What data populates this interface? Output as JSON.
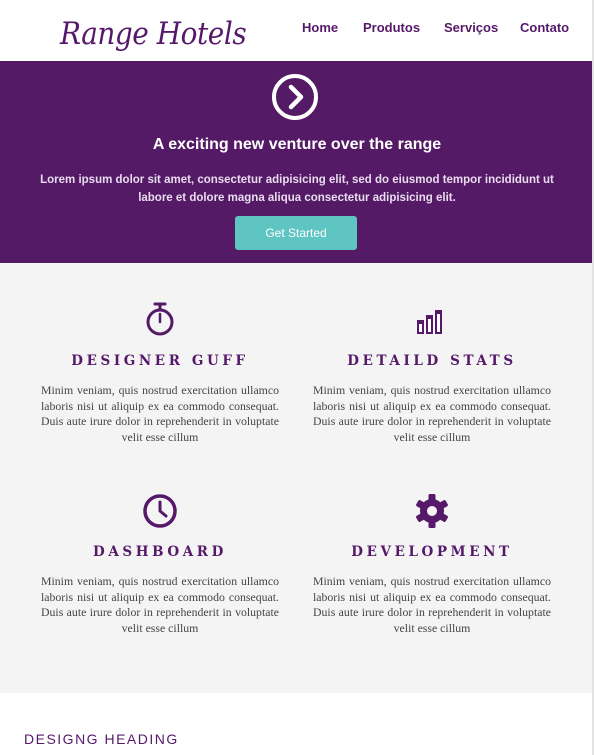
{
  "header": {
    "logo": "Range Hotels",
    "nav": [
      {
        "label": "Home"
      },
      {
        "label": "Produtos"
      },
      {
        "label": "Serviços"
      },
      {
        "label": "Contato"
      }
    ]
  },
  "hero": {
    "icon": "chevron-right-circle-icon",
    "title": "A exciting new venture over the range",
    "text": "Lorem ipsum dolor sit amet, consectetur adipisicing elit, sed do eiusmod tempor incididunt ut labore et dolore magna aliqua consectetur adipisicing elit.",
    "button": "Get Started"
  },
  "features": [
    {
      "icon": "stopwatch-icon",
      "title": "DESIGNER GUFF",
      "text": "Minim veniam, quis nostrud exercitation ullamco laboris nisi ut aliquip ex ea commodo consequat. Duis aute irure dolor in reprehenderit in voluptate velit esse cillum"
    },
    {
      "icon": "bar-chart-icon",
      "title": "DETAILD STATS",
      "text": "Minim veniam, quis nostrud exercitation ullamco laboris nisi ut aliquip ex ea commodo consequat. Duis aute irure dolor in reprehenderit in voluptate velit esse cillum"
    },
    {
      "icon": "clock-icon",
      "title": "DASHBOARD",
      "text": "Minim veniam, quis nostrud exercitation ullamco laboris nisi ut aliquip ex ea commodo consequat. Duis aute irure dolor in reprehenderit in voluptate velit esse cillum"
    },
    {
      "icon": "gear-icon",
      "title": "DEVELOPMENT",
      "text": "Minim veniam, quis nostrud exercitation ullamco laboris nisi ut aliquip ex ea commodo consequat. Duis aute irure dolor in reprehenderit in voluptate velit esse cillum"
    }
  ],
  "bottom": {
    "heading": "DESIGNG HEADING"
  },
  "colors": {
    "brand": "#56196a",
    "hero_bg": "#541a66",
    "button": "#5ec5c3",
    "features_bg": "#f4f4f4"
  }
}
